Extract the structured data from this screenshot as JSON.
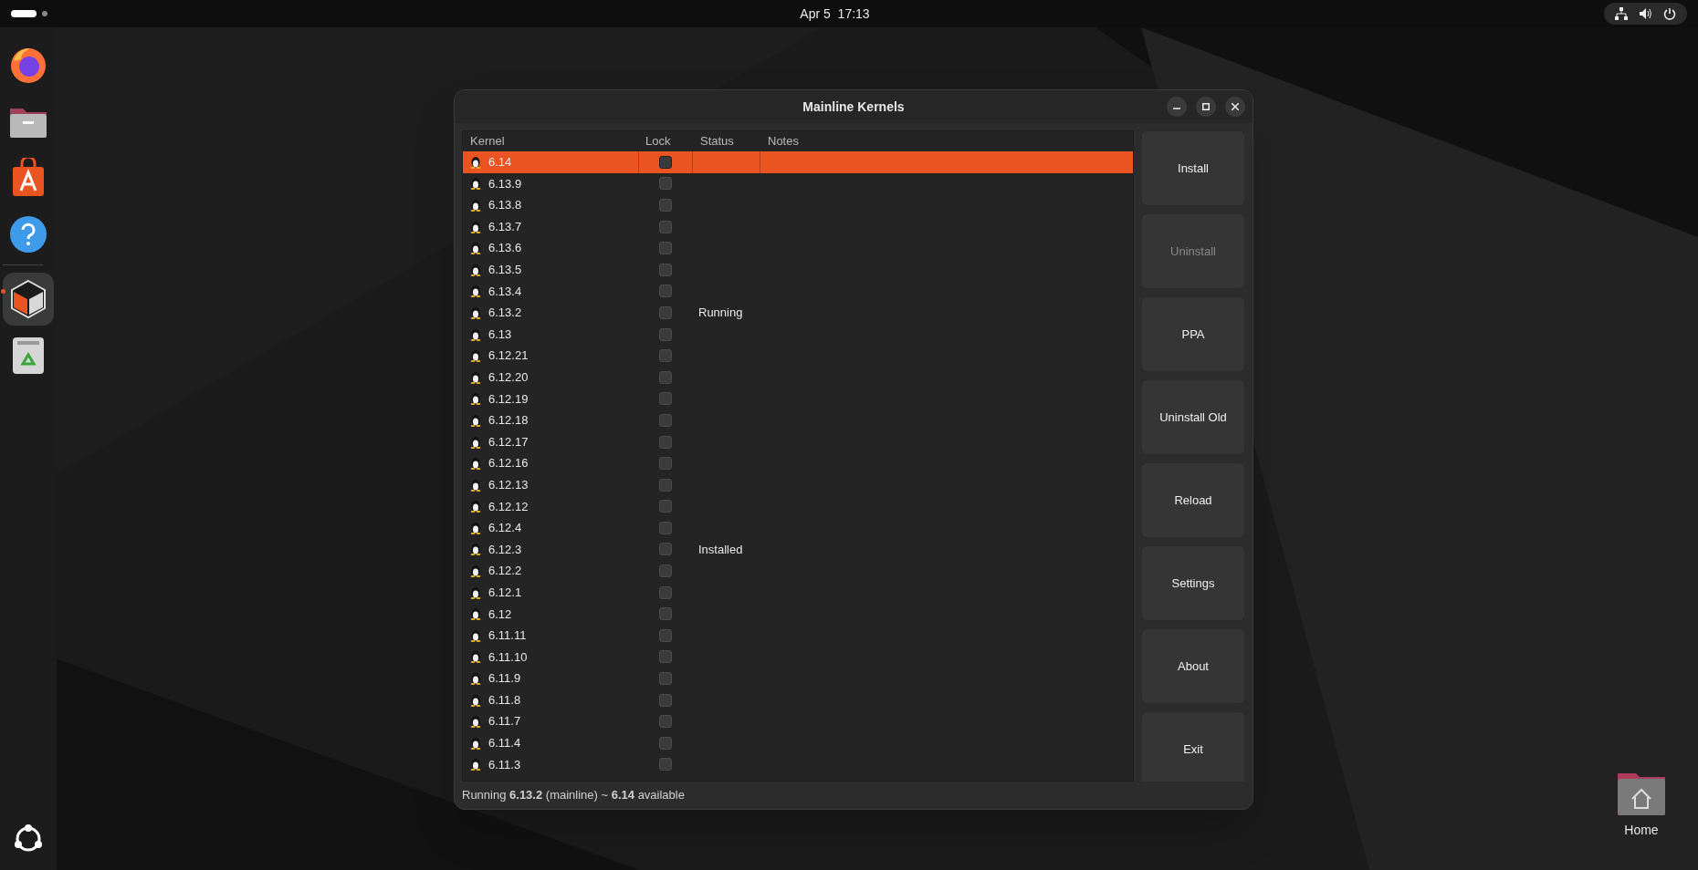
{
  "top_bar": {
    "clock": "Apr 5  17:13"
  },
  "dock": {
    "items": [
      {
        "kind": "firefox",
        "running": false
      },
      {
        "kind": "files",
        "running": false
      },
      {
        "kind": "store",
        "running": false
      },
      {
        "kind": "help",
        "running": false
      },
      {
        "kind": "mainline",
        "running": true
      },
      {
        "kind": "trash",
        "running": false
      }
    ]
  },
  "desktop_icons": [
    {
      "label": "Home"
    }
  ],
  "window": {
    "title": "Mainline Kernels",
    "table": {
      "columns": [
        "Kernel",
        "Lock",
        "Status",
        "Notes"
      ],
      "rows": [
        {
          "kernel": "6.14",
          "locked": false,
          "status": "",
          "selected": true
        },
        {
          "kernel": "6.13.9",
          "locked": false,
          "status": "",
          "selected": false
        },
        {
          "kernel": "6.13.8",
          "locked": false,
          "status": "",
          "selected": false
        },
        {
          "kernel": "6.13.7",
          "locked": false,
          "status": "",
          "selected": false
        },
        {
          "kernel": "6.13.6",
          "locked": false,
          "status": "",
          "selected": false
        },
        {
          "kernel": "6.13.5",
          "locked": false,
          "status": "",
          "selected": false
        },
        {
          "kernel": "6.13.4",
          "locked": false,
          "status": "",
          "selected": false
        },
        {
          "kernel": "6.13.2",
          "locked": false,
          "status": "Running",
          "selected": false
        },
        {
          "kernel": "6.13",
          "locked": false,
          "status": "",
          "selected": false
        },
        {
          "kernel": "6.12.21",
          "locked": false,
          "status": "",
          "selected": false
        },
        {
          "kernel": "6.12.20",
          "locked": false,
          "status": "",
          "selected": false
        },
        {
          "kernel": "6.12.19",
          "locked": false,
          "status": "",
          "selected": false
        },
        {
          "kernel": "6.12.18",
          "locked": false,
          "status": "",
          "selected": false
        },
        {
          "kernel": "6.12.17",
          "locked": false,
          "status": "",
          "selected": false
        },
        {
          "kernel": "6.12.16",
          "locked": false,
          "status": "",
          "selected": false
        },
        {
          "kernel": "6.12.13",
          "locked": false,
          "status": "",
          "selected": false
        },
        {
          "kernel": "6.12.12",
          "locked": false,
          "status": "",
          "selected": false
        },
        {
          "kernel": "6.12.4",
          "locked": false,
          "status": "",
          "selected": false
        },
        {
          "kernel": "6.12.3",
          "locked": false,
          "status": "Installed",
          "selected": false
        },
        {
          "kernel": "6.12.2",
          "locked": false,
          "status": "",
          "selected": false
        },
        {
          "kernel": "6.12.1",
          "locked": false,
          "status": "",
          "selected": false
        },
        {
          "kernel": "6.12",
          "locked": false,
          "status": "",
          "selected": false
        },
        {
          "kernel": "6.11.11",
          "locked": false,
          "status": "",
          "selected": false
        },
        {
          "kernel": "6.11.10",
          "locked": false,
          "status": "",
          "selected": false
        },
        {
          "kernel": "6.11.9",
          "locked": false,
          "status": "",
          "selected": false
        },
        {
          "kernel": "6.11.8",
          "locked": false,
          "status": "",
          "selected": false
        },
        {
          "kernel": "6.11.7",
          "locked": false,
          "status": "",
          "selected": false
        },
        {
          "kernel": "6.11.4",
          "locked": false,
          "status": "",
          "selected": false
        },
        {
          "kernel": "6.11.3",
          "locked": false,
          "status": "",
          "selected": false
        }
      ]
    },
    "buttons": [
      {
        "label": "Install",
        "disabled": false
      },
      {
        "label": "Uninstall",
        "disabled": true
      },
      {
        "label": "PPA",
        "disabled": false
      },
      {
        "label": "Uninstall Old",
        "disabled": false
      },
      {
        "label": "Reload",
        "disabled": false
      },
      {
        "label": "Settings",
        "disabled": false
      },
      {
        "label": "About",
        "disabled": false
      },
      {
        "label": "Exit",
        "disabled": false
      }
    ],
    "status_bar": "Running **6.13.2** (mainline) ~ **6.14** available"
  }
}
